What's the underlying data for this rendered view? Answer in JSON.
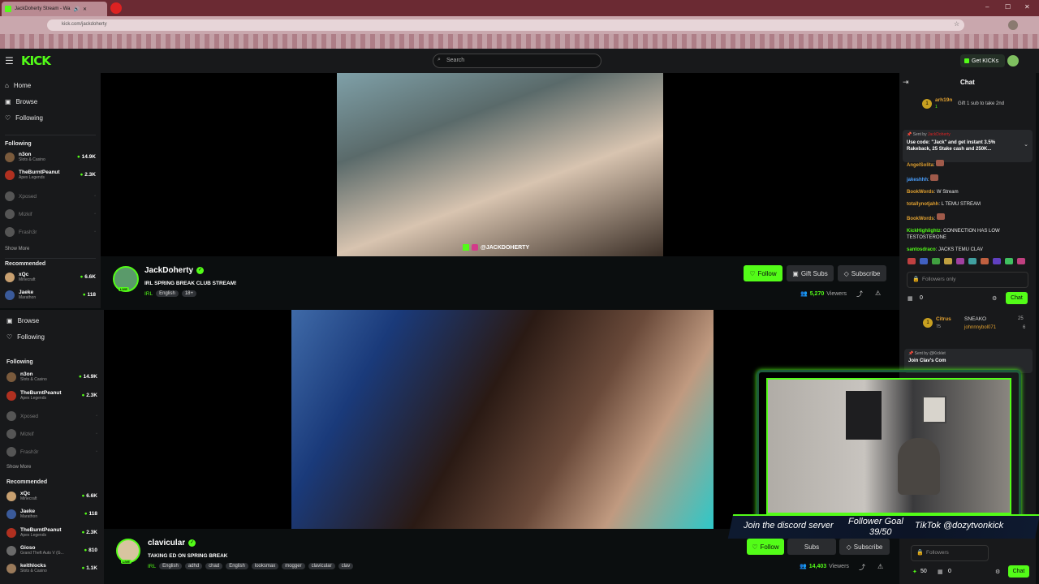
{
  "browser": {
    "tab_title": "JackDoherty Stream - Wa",
    "url": "kick.com/jackdoherty",
    "window_controls": [
      "–",
      "☐",
      "✕"
    ]
  },
  "header": {
    "logo": "KICK",
    "search_placeholder": "Search",
    "get_kicks": "Get KICKs"
  },
  "sidebar": {
    "nav": [
      "Home",
      "Browse",
      "Following"
    ],
    "following_title": "Following",
    "following": [
      {
        "name": "n3on",
        "game": "Slots & Casino",
        "count": "14.9K",
        "live": true
      },
      {
        "name": "TheBurntPeanut",
        "game": "Apex Legends",
        "count": "2.3K",
        "live": true
      },
      {
        "name": "Xposed",
        "game": "",
        "count": "",
        "live": false
      },
      {
        "name": "Mizkif",
        "game": "",
        "count": "",
        "live": false
      },
      {
        "name": "Frash3r",
        "game": "",
        "count": "",
        "live": false
      }
    ],
    "show_more": "Show More",
    "recommended_title": "Recommended",
    "recommended": [
      {
        "name": "xQc",
        "game": "Minecraft",
        "count": "6.6K"
      },
      {
        "name": "Jaeke",
        "game": "Marathon",
        "count": "118"
      }
    ]
  },
  "sidebar2": {
    "nav": [
      "Browse",
      "Following"
    ],
    "following_title": "Following",
    "following": [
      {
        "name": "n3on",
        "game": "Slots & Casino",
        "count": "14.9K",
        "live": true
      },
      {
        "name": "TheBurntPeanut",
        "game": "Apex Legends",
        "count": "2.3K",
        "live": true
      },
      {
        "name": "Xposed",
        "game": "",
        "count": "",
        "live": false
      },
      {
        "name": "Mizkif",
        "game": "",
        "count": "",
        "live": false
      },
      {
        "name": "Frash3r",
        "game": "",
        "count": "",
        "live": false
      }
    ],
    "show_more": "Show More",
    "recommended_title": "Recommended",
    "recommended": [
      {
        "name": "xQc",
        "game": "Minecraft",
        "count": "6.6K"
      },
      {
        "name": "Jaeke",
        "game": "Marathon",
        "count": "118"
      },
      {
        "name": "TheBurntPeanut",
        "game": "Apex Legends",
        "count": "2.3K"
      },
      {
        "name": "Gioso",
        "game": "Grand Theft Auto V (G...",
        "count": "810"
      },
      {
        "name": "keithlocks",
        "game": "Slots & Casino",
        "count": "1.1K"
      }
    ]
  },
  "stream1": {
    "overlay_handle": "@JACKDOHERTY",
    "name": "JackDoherty",
    "title": "IRL SPRING BREAK CLUB STREAM!",
    "category": "IRL",
    "tags": [
      "English",
      "18+"
    ],
    "live_badge": "LIVE",
    "follow": "Follow",
    "gift_subs": "Gift Subs",
    "subscribe": "Subscribe",
    "viewers": "5,270",
    "viewers_label": "Viewers"
  },
  "stream2": {
    "name": "clavicular",
    "title": "TAKING ED ON SPRING BREAK",
    "category": "IRL",
    "tags": [
      "English",
      "adhd",
      "chad",
      "English",
      "looksmax",
      "mogger",
      "clavicular",
      "clav"
    ],
    "live_badge": "LIVE",
    "follow": "Follow",
    "gift_subs": "Subs",
    "subscribe": "Subscribe",
    "viewers": "14,403",
    "viewers_label": "Viewers"
  },
  "chat1": {
    "title": "Chat",
    "top_gifter": {
      "rank": "1",
      "name": "arh19n",
      "count": "1",
      "note": "Gift 1 sub to take 2nd"
    },
    "pinned": {
      "sent_by": "Sent by",
      "user": "JackDoherty",
      "text": "Use code: \"Jack\" and get instant 3.5% Rakeback, 25 Stake cash and 250K..."
    },
    "messages": [
      {
        "user": "AngelSolita",
        "text": "",
        "color": "#e0a030"
      },
      {
        "user": "jakeshhh",
        "text": "",
        "color": "#4aa0ff"
      },
      {
        "user": "BookWords",
        "text": "W Stream",
        "color": "#e0a030"
      },
      {
        "user": "totallynotjahh",
        "text": "L TEMU STREAM",
        "color": "#e0a030"
      },
      {
        "user": "BookWords",
        "text": "",
        "color": "#e0a030"
      },
      {
        "user": "KickHighlightz",
        "text": "CONNECTION HAS LOW TESTOSTERONE",
        "color": "#53fc18"
      },
      {
        "user": "santosdraco",
        "text": "JACKS TEMU CLAV",
        "color": "#53fc18"
      }
    ],
    "input_placeholder": "Followers only",
    "points": "0",
    "send": "Chat"
  },
  "chat2": {
    "top_gifter": {
      "rank": "1",
      "name": "Citrus",
      "count": "75",
      "second": "SNEAKO",
      "second_count": "25",
      "third": "johnnnybol071",
      "third_count": "6"
    },
    "pinned": {
      "sent_by": "Sent by",
      "user": "@Kicklet",
      "text": "Join Clav's Com"
    },
    "input_placeholder": "Followers",
    "points": "50",
    "points2": "0",
    "send": "Chat"
  },
  "overlay": {
    "banner": [
      "Join the discord server",
      "Follower Goal",
      "39/50",
      "TikTok @dozytvonkick"
    ]
  },
  "colors": {
    "brand": "#53fc18",
    "bg": "#0b0e0f",
    "panel": "#18191b"
  }
}
